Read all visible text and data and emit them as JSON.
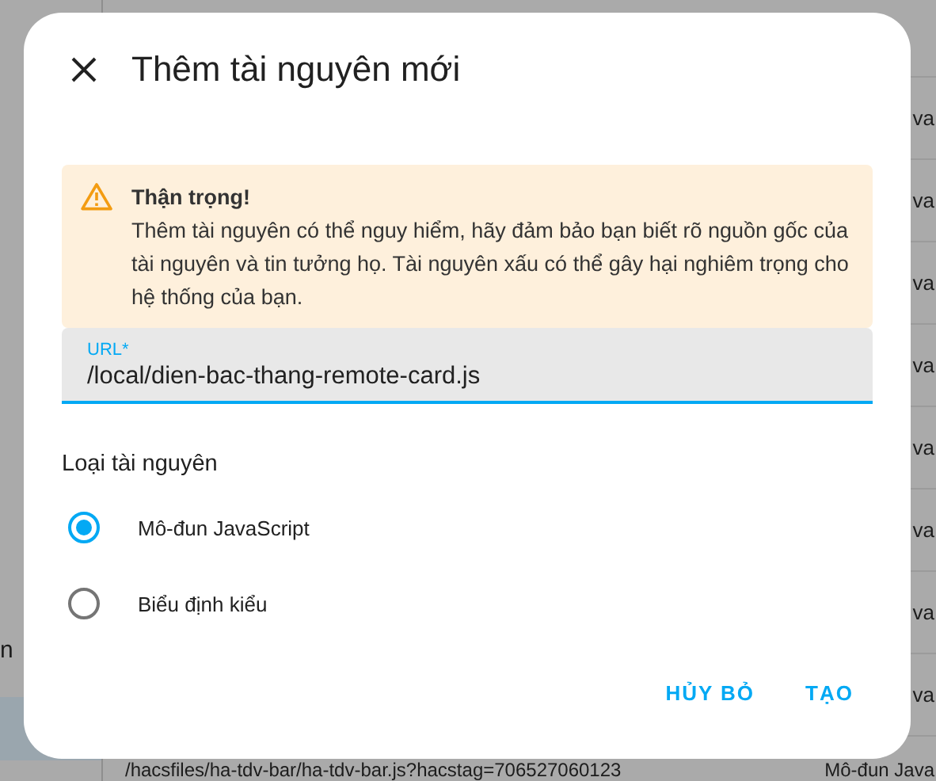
{
  "background": {
    "sidebar": {
      "items": [
        {
          "label": "n",
          "selected": false
        },
        {
          "selected": true
        }
      ]
    },
    "table": {
      "rows": [
        {
          "column_2": "va"
        },
        {
          "column_2": "va"
        },
        {
          "column_2": "va"
        },
        {
          "column_2": "va"
        },
        {
          "column_2": "va"
        },
        {
          "column_2": "va"
        },
        {
          "column_2": "va"
        },
        {
          "column_2": "va"
        },
        {
          "column_1": "/hacsfiles/ha-tdv-bar/ha-tdv-bar.js?hacstag=706527060123",
          "column_2": "Mô-đun Java"
        }
      ]
    }
  },
  "dialog": {
    "title": "Thêm tài nguyên mới",
    "warning": {
      "title": "Thận trọng!",
      "message": "Thêm tài nguyên có thể nguy hiểm, hãy đảm bảo bạn biết rõ nguồn gốc của tài nguyên và tin tưởng họ. Tài nguyên xấu có thể gây hại nghiêm trọng cho hệ thống của bạn."
    },
    "url_field": {
      "label": "URL*",
      "value": "/local/dien-bac-thang-remote-card.js"
    },
    "resource_type": {
      "label": "Loại tài nguyên",
      "options": [
        {
          "label": "Mô-đun JavaScript",
          "selected": true
        },
        {
          "label": "Biểu định kiểu",
          "selected": false
        }
      ]
    },
    "buttons": [
      "HỦY BỎ",
      "TẠO"
    ]
  }
}
